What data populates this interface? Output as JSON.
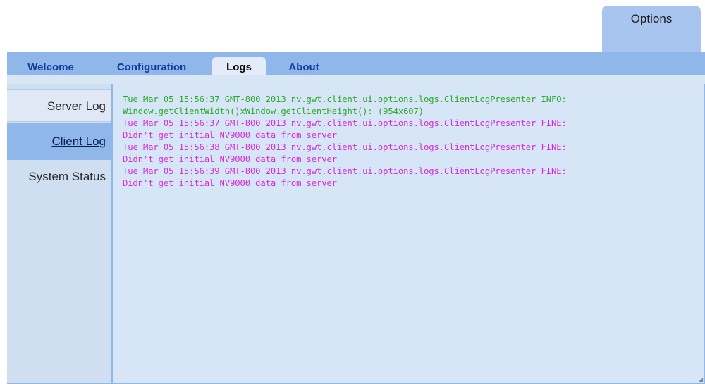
{
  "options_tab": {
    "label": "Options"
  },
  "tabs": [
    {
      "label": "Welcome"
    },
    {
      "label": "Configuration"
    },
    {
      "label": "Logs"
    },
    {
      "label": "About"
    }
  ],
  "sidebar": {
    "items": [
      {
        "label": "Server Log"
      },
      {
        "label": "Client Log"
      },
      {
        "label": "System Status"
      }
    ]
  },
  "log": {
    "lines": [
      {
        "level": "info",
        "text": "Tue Mar 05 15:56:37 GMT-800 2013 nv.gwt.client.ui.options.logs.ClientLogPresenter INFO:"
      },
      {
        "level": "info",
        "text": "Window.getClientWidth()xWindow.getClientHeight(): (954x607)"
      },
      {
        "level": "fine",
        "text": "Tue Mar 05 15:56:37 GMT-800 2013 nv.gwt.client.ui.options.logs.ClientLogPresenter FINE:"
      },
      {
        "level": "fine",
        "text": "Didn't get initial NV9000 data from server"
      },
      {
        "level": "fine",
        "text": "Tue Mar 05 15:56:38 GMT-800 2013 nv.gwt.client.ui.options.logs.ClientLogPresenter FINE:"
      },
      {
        "level": "fine",
        "text": "Didn't get initial NV9000 data from server"
      },
      {
        "level": "fine",
        "text": "Tue Mar 05 15:56:39 GMT-800 2013 nv.gwt.client.ui.options.logs.ClientLogPresenter FINE:"
      },
      {
        "level": "fine",
        "text": "Didn't get initial NV9000 data from server"
      }
    ]
  },
  "colors": {
    "info": "#2aa82a",
    "fine": "#d62bd6",
    "frame": "#8fb7ea",
    "tab_text": "#0f3f9a"
  }
}
